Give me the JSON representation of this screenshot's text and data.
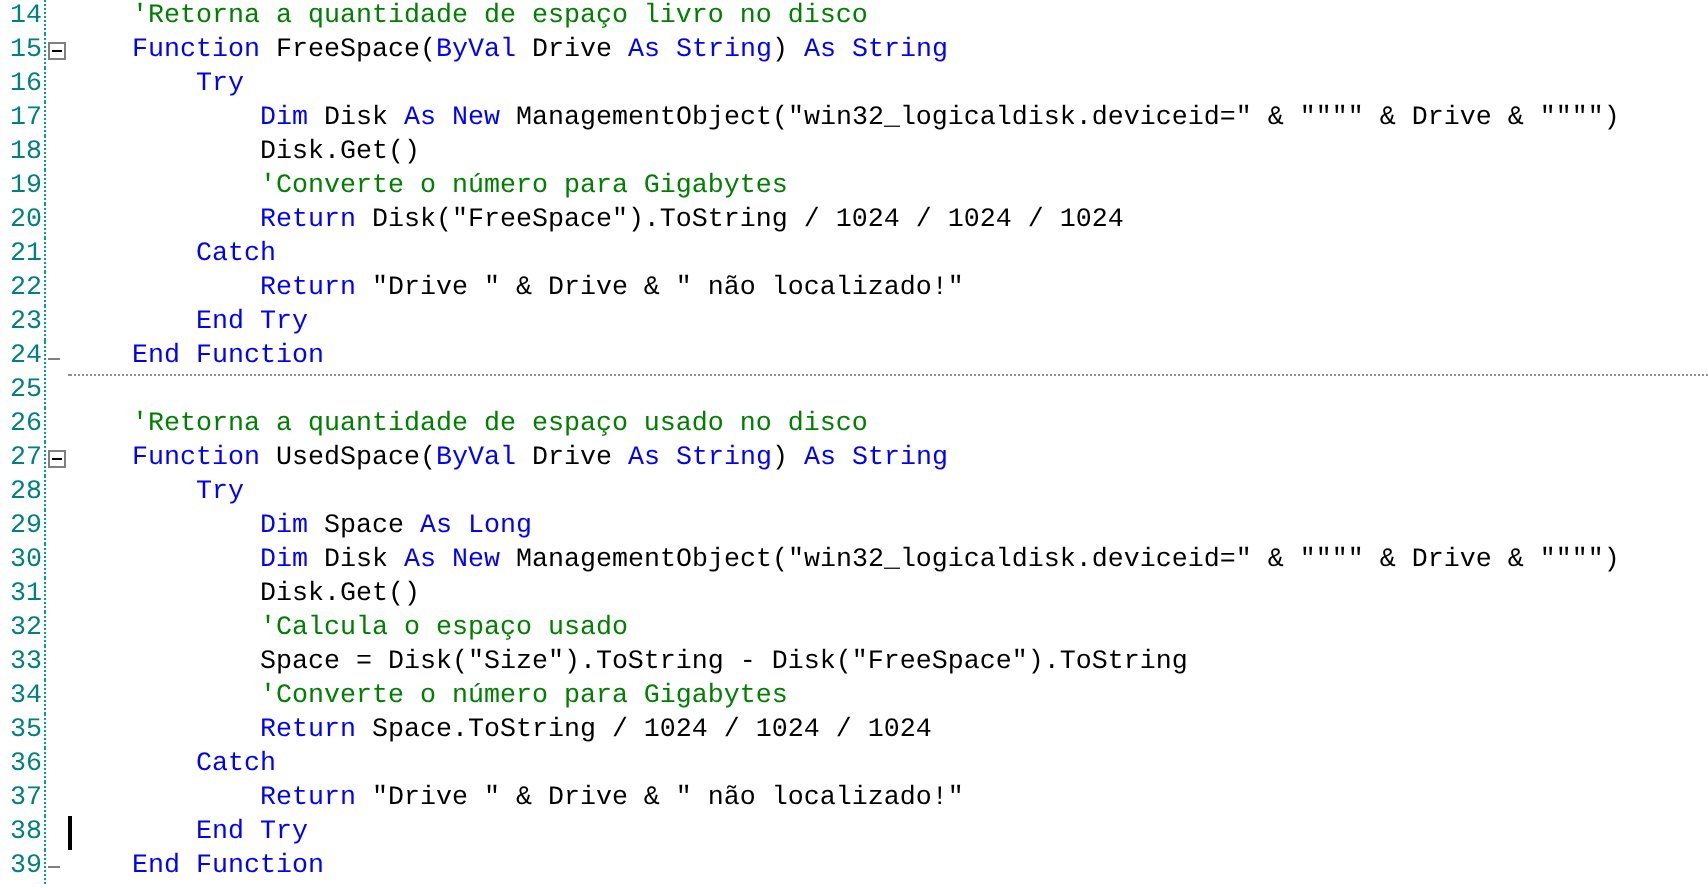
{
  "editor": {
    "lines": [
      {
        "number": "14",
        "kind": "line",
        "tokens": [
          {
            "kind": "comment",
            "text": "    'Retorna a quantidade de espaço livro no disco"
          }
        ]
      },
      {
        "number": "15",
        "kind": "block_start",
        "tokens": [
          {
            "kind": "keyword",
            "text": "    Function"
          },
          {
            "kind": "plain",
            "text": " FreeSpace("
          },
          {
            "kind": "keyword",
            "text": "ByVal"
          },
          {
            "kind": "plain",
            "text": " Drive "
          },
          {
            "kind": "keyword",
            "text": "As String"
          },
          {
            "kind": "plain",
            "text": ") "
          },
          {
            "kind": "keyword",
            "text": "As String"
          }
        ]
      },
      {
        "number": "16",
        "kind": "line",
        "tokens": [
          {
            "kind": "keyword",
            "text": "        Try"
          }
        ]
      },
      {
        "number": "17",
        "kind": "line",
        "tokens": [
          {
            "kind": "keyword",
            "text": "            Dim"
          },
          {
            "kind": "plain",
            "text": " Disk "
          },
          {
            "kind": "keyword",
            "text": "As New"
          },
          {
            "kind": "plain",
            "text": " ManagementObject(\"win32_logicaldisk.deviceid=\" & \"\"\"\" & Drive & \"\"\"\")"
          }
        ]
      },
      {
        "number": "18",
        "kind": "line",
        "tokens": [
          {
            "kind": "plain",
            "text": "            Disk.Get()"
          }
        ]
      },
      {
        "number": "19",
        "kind": "line",
        "tokens": [
          {
            "kind": "comment",
            "text": "            'Converte o número para Gigabytes"
          }
        ]
      },
      {
        "number": "20",
        "kind": "line",
        "tokens": [
          {
            "kind": "keyword",
            "text": "            Return"
          },
          {
            "kind": "plain",
            "text": " Disk(\"FreeSpace\").ToString / 1024 / 1024 / 1024"
          }
        ]
      },
      {
        "number": "21",
        "kind": "line",
        "tokens": [
          {
            "kind": "keyword",
            "text": "        Catch"
          }
        ]
      },
      {
        "number": "22",
        "kind": "line",
        "tokens": [
          {
            "kind": "keyword",
            "text": "            Return"
          },
          {
            "kind": "plain",
            "text": " \"Drive \" & Drive & \" não localizado!\""
          }
        ]
      },
      {
        "number": "23",
        "kind": "line",
        "tokens": [
          {
            "kind": "keyword",
            "text": "        End Try"
          }
        ]
      },
      {
        "number": "24",
        "kind": "block_end",
        "separator": true,
        "tokens": [
          {
            "kind": "keyword",
            "text": "    End Function"
          }
        ]
      },
      {
        "number": "25",
        "kind": "line"
      },
      {
        "number": "26",
        "kind": "line",
        "tokens": [
          {
            "kind": "comment",
            "text": "    'Retorna a quantidade de espaço usado no disco"
          }
        ]
      },
      {
        "number": "27",
        "kind": "block_start",
        "tokens": [
          {
            "kind": "keyword",
            "text": "    Function"
          },
          {
            "kind": "plain",
            "text": " UsedSpace("
          },
          {
            "kind": "keyword",
            "text": "ByVal"
          },
          {
            "kind": "plain",
            "text": " Drive "
          },
          {
            "kind": "keyword",
            "text": "As String"
          },
          {
            "kind": "plain",
            "text": ") "
          },
          {
            "kind": "keyword",
            "text": "As String"
          }
        ]
      },
      {
        "number": "28",
        "kind": "line",
        "tokens": [
          {
            "kind": "keyword",
            "text": "        Try"
          }
        ]
      },
      {
        "number": "29",
        "kind": "line",
        "tokens": [
          {
            "kind": "keyword",
            "text": "            Dim"
          },
          {
            "kind": "plain",
            "text": " Space "
          },
          {
            "kind": "keyword",
            "text": "As Long"
          }
        ]
      },
      {
        "number": "30",
        "kind": "line",
        "tokens": [
          {
            "kind": "keyword",
            "text": "            Dim"
          },
          {
            "kind": "plain",
            "text": " Disk "
          },
          {
            "kind": "keyword",
            "text": "As New"
          },
          {
            "kind": "plain",
            "text": " ManagementObject(\"win32_logicaldisk.deviceid=\" & \"\"\"\" & Drive & \"\"\"\")"
          }
        ]
      },
      {
        "number": "31",
        "kind": "line",
        "tokens": [
          {
            "kind": "plain",
            "text": "            Disk.Get()"
          }
        ]
      },
      {
        "number": "32",
        "kind": "line",
        "tokens": [
          {
            "kind": "comment",
            "text": "            'Calcula o espaço usado"
          }
        ]
      },
      {
        "number": "33",
        "kind": "line",
        "tokens": [
          {
            "kind": "plain",
            "text": "            Space = Disk(\"Size\").ToString - Disk(\"FreeSpace\").ToString"
          }
        ]
      },
      {
        "number": "34",
        "kind": "line",
        "tokens": [
          {
            "kind": "comment",
            "text": "            'Converte o número para Gigabytes"
          }
        ]
      },
      {
        "number": "35",
        "kind": "line",
        "tokens": [
          {
            "kind": "keyword",
            "text": "            Return"
          },
          {
            "kind": "plain",
            "text": " Space.ToString / 1024 / 1024 / 1024"
          }
        ]
      },
      {
        "number": "36",
        "kind": "line",
        "tokens": [
          {
            "kind": "keyword",
            "text": "        Catch"
          }
        ]
      },
      {
        "number": "37",
        "kind": "line",
        "tokens": [
          {
            "kind": "keyword",
            "text": "            Return"
          },
          {
            "kind": "plain",
            "text": " \"Drive \" & Drive & \" não localizado!\""
          }
        ]
      },
      {
        "number": "38",
        "kind": "line",
        "cursor": true,
        "tokens": [
          {
            "kind": "keyword",
            "text": "        End Try"
          }
        ]
      },
      {
        "number": "39",
        "kind": "block_end",
        "tokens": [
          {
            "kind": "keyword",
            "text": "    End Function"
          }
        ]
      }
    ]
  }
}
